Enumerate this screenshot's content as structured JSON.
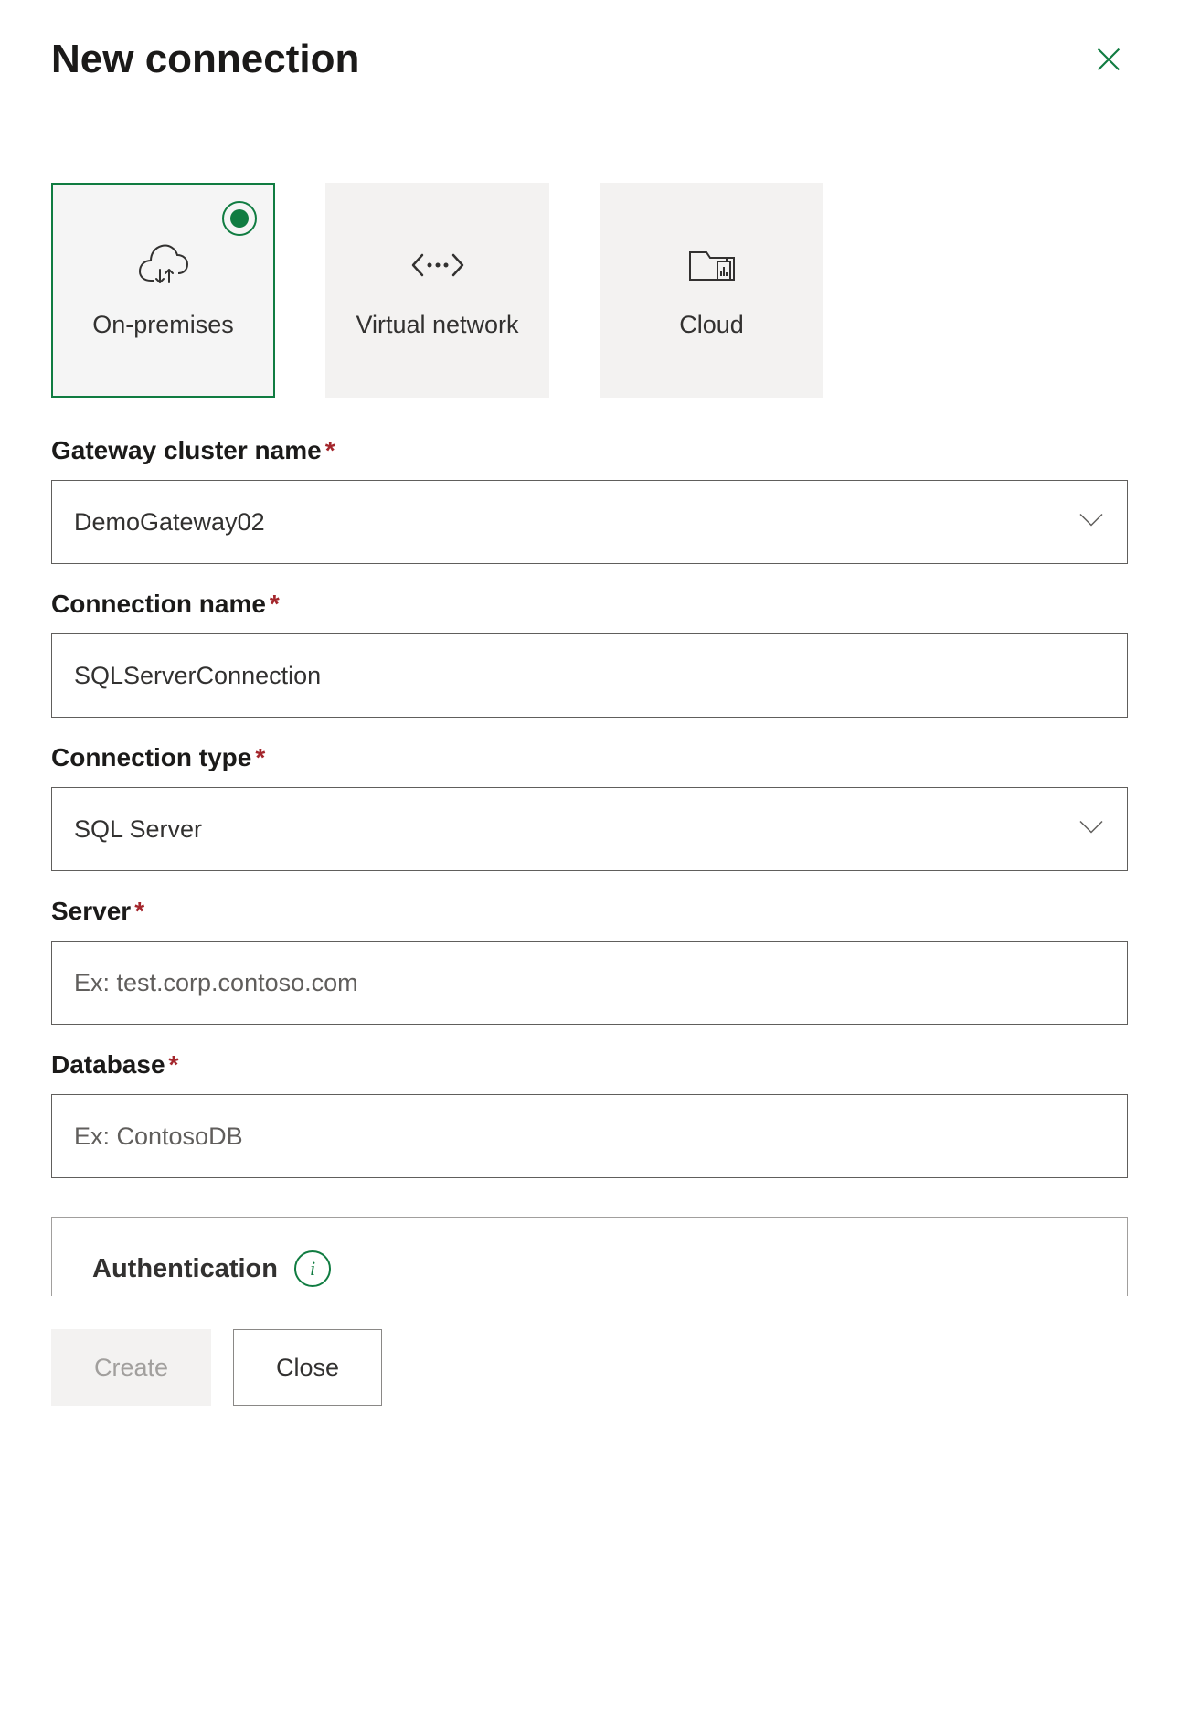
{
  "dialog": {
    "title": "New connection"
  },
  "connType": {
    "options": [
      {
        "key": "on-premises",
        "label": "On-premises",
        "selected": true
      },
      {
        "key": "virtual-network",
        "label": "Virtual network",
        "selected": false
      },
      {
        "key": "cloud",
        "label": "Cloud",
        "selected": false
      }
    ]
  },
  "fields": {
    "gatewayCluster": {
      "label": "Gateway cluster name",
      "required": true,
      "value": "DemoGateway02"
    },
    "connectionName": {
      "label": "Connection name",
      "required": true,
      "value": "SQLServerConnection"
    },
    "connectionType": {
      "label": "Connection type",
      "required": true,
      "value": "SQL Server"
    },
    "server": {
      "label": "Server",
      "required": true,
      "value": "",
      "placeholder": "Ex: test.corp.contoso.com"
    },
    "database": {
      "label": "Database",
      "required": true,
      "value": "",
      "placeholder": "Ex: ContosoDB"
    }
  },
  "auth": {
    "title": "Authentication"
  },
  "footer": {
    "create": "Create",
    "close": "Close"
  }
}
